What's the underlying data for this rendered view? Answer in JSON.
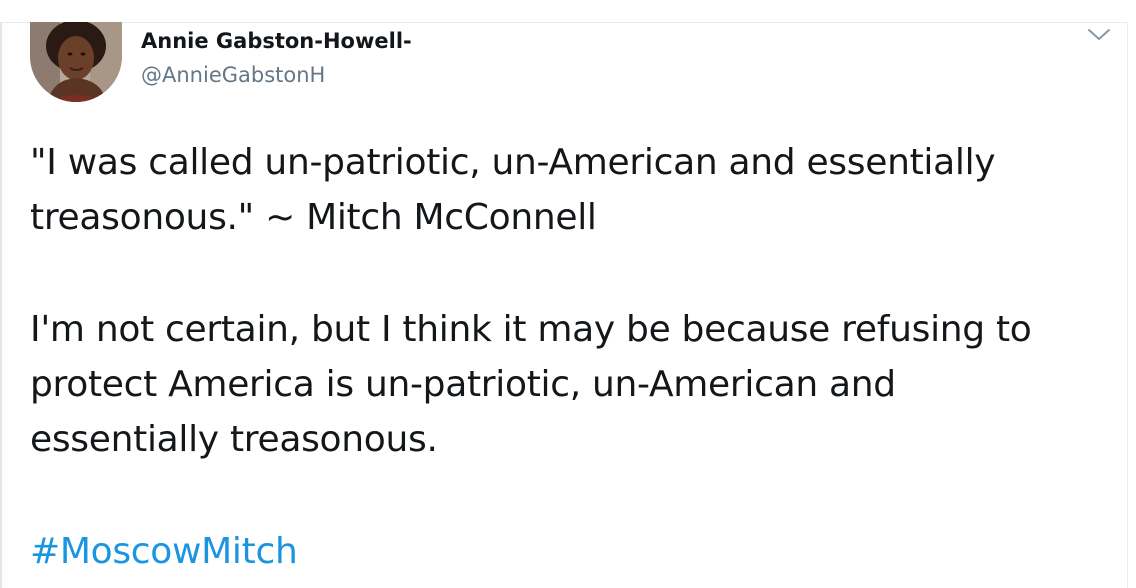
{
  "tweet": {
    "author": {
      "display_name": "Annie Gabston-Howell-",
      "handle": "@AnnieGabstonH"
    },
    "menu_icon": "chevron-down-icon",
    "paragraphs": [
      [
        "\"I was called un-patriotic, un-American and essentially",
        "treasonous.\" ~ Mitch McConnell"
      ],
      [
        "I'm not certain, but I think it may be because refusing to",
        "protect America is un-patriotic, un-American and",
        "essentially treasonous."
      ]
    ],
    "hashtag": "#MoscowMitch",
    "colors": {
      "text": "#14171a",
      "secondary": "#657786",
      "link": "#1b95e0"
    }
  }
}
